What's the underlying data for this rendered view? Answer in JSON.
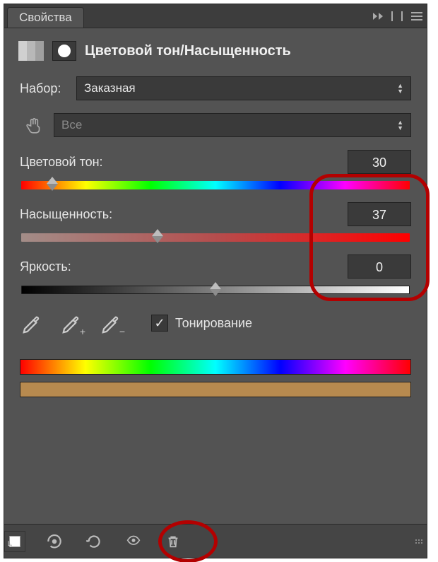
{
  "tabbar": {
    "tab_label": "Свойства"
  },
  "header": {
    "title": "Цветовой тон/Насыщенность"
  },
  "preset": {
    "label": "Набор:",
    "selected": "Заказная"
  },
  "channel": {
    "selected": "Все"
  },
  "sliders": {
    "hue": {
      "label": "Цветовой тон:",
      "value": "30",
      "thumb_pct": 8
    },
    "saturation": {
      "label": "Насыщенность:",
      "value": "37",
      "thumb_pct": 35
    },
    "lightness": {
      "label": "Яркость:",
      "value": "0",
      "thumb_pct": 50
    }
  },
  "colorize": {
    "label": "Тонирование",
    "checked": true
  },
  "tone_bar_color": "#b78a4f"
}
